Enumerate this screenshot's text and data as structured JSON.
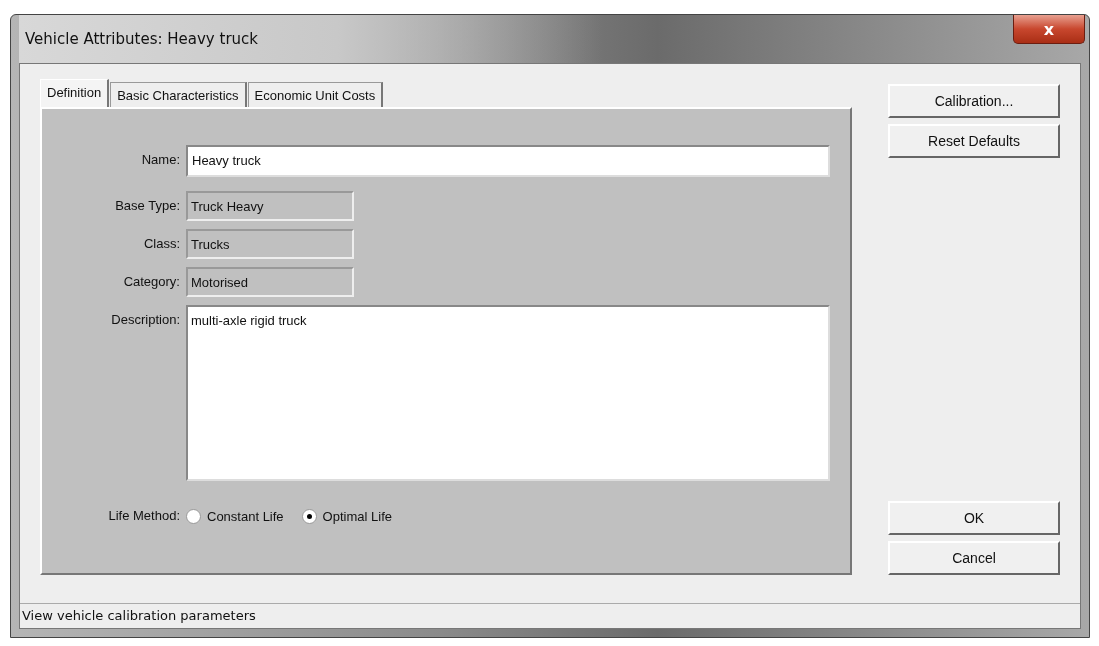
{
  "window": {
    "title": "Vehicle Attributes: Heavy truck",
    "close": "x"
  },
  "tabs": [
    {
      "label": "Definition",
      "selected": true
    },
    {
      "label": "Basic Characteristics",
      "selected": false
    },
    {
      "label": "Economic Unit Costs",
      "selected": false
    }
  ],
  "fields": [
    {
      "label": "Name:",
      "kind": "input",
      "value": "Heavy truck"
    },
    {
      "label": "Base Type:",
      "kind": "readonly",
      "value": "Truck Heavy"
    },
    {
      "label": "Class:",
      "kind": "readonly",
      "value": "Trucks"
    },
    {
      "label": "Category:",
      "kind": "readonly",
      "value": "Motorised"
    },
    {
      "label": "Description:",
      "kind": "textarea",
      "value": "multi-axle rigid truck"
    }
  ],
  "life_method": {
    "label": "Life Method:",
    "options": [
      {
        "label": "Constant Life",
        "selected": false
      },
      {
        "label": "Optimal Life",
        "selected": true
      }
    ]
  },
  "side_buttons": [
    "Calibration...",
    "Reset Defaults"
  ],
  "buttons": [
    "OK",
    "Cancel"
  ],
  "status_bar": "View vehicle calibration parameters"
}
